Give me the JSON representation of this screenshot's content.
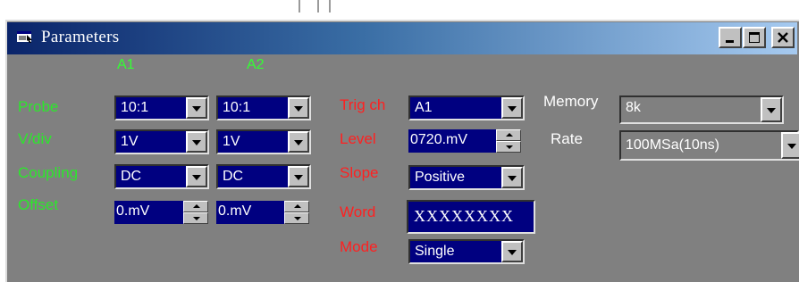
{
  "window": {
    "title": "Parameters",
    "title_icon": "window-app-icon",
    "minimize_icon": "minimize-icon",
    "maximize_icon": "maximize-icon",
    "close_icon": "close-icon"
  },
  "channels": {
    "a1_header": "A1",
    "a2_header": "A2"
  },
  "labels": {
    "probe": "Probe",
    "vdiv": "V/div",
    "coupling": "Coupling",
    "offset": "Offset",
    "trig_ch": "Trig ch",
    "level": "Level",
    "slope": "Slope",
    "word": "Word",
    "mode": "Mode",
    "memory": "Memory",
    "rate": "Rate"
  },
  "a1": {
    "probe": "10:1",
    "vdiv": "1V",
    "coupling": "DC",
    "offset": "0.mV"
  },
  "a2": {
    "probe": "10:1",
    "vdiv": "1V",
    "coupling": "DC",
    "offset": "0.mV"
  },
  "trigger": {
    "channel": "A1",
    "level": "0720.mV",
    "slope": "Positive",
    "word": "XXXXXXXX",
    "mode": "Single"
  },
  "acquisition": {
    "memory": "8k",
    "rate": "100MSa(10ns)"
  },
  "colors": {
    "channel_label": "#2be82b",
    "trigger_label": "#ff2020",
    "field_bg": "#000080",
    "panel_bg": "#808080"
  }
}
